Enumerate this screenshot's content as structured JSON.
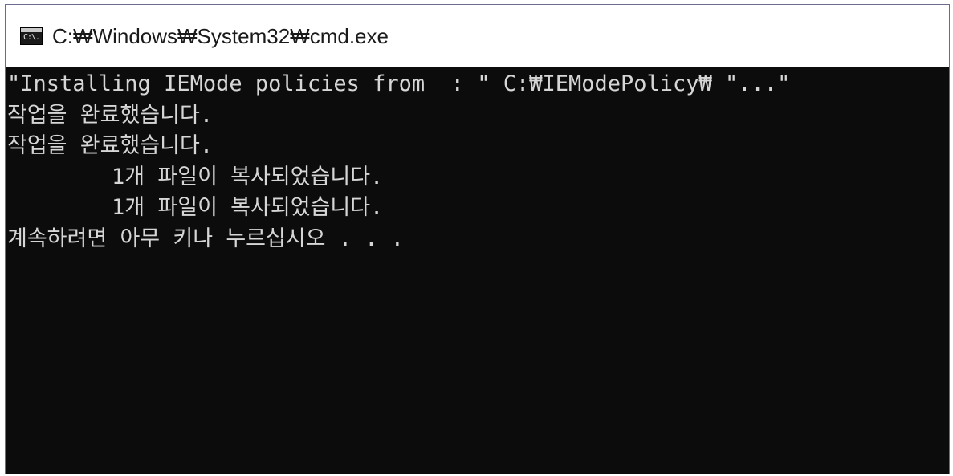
{
  "window": {
    "title": "C:₩Windows₩System32₩cmd.exe",
    "icon": "cmd-icon",
    "icon_glyph": "C:\\."
  },
  "console": {
    "lines": [
      "\"Installing IEMode policies from  : \" C:₩IEModePolicy₩ \"...\"",
      "작업을 완료했습니다.",
      "작업을 완료했습니다.",
      "        1개 파일이 복사되었습니다.",
      "        1개 파일이 복사되었습니다.",
      "계속하려면 아무 키나 누르십시오 . . ."
    ]
  }
}
